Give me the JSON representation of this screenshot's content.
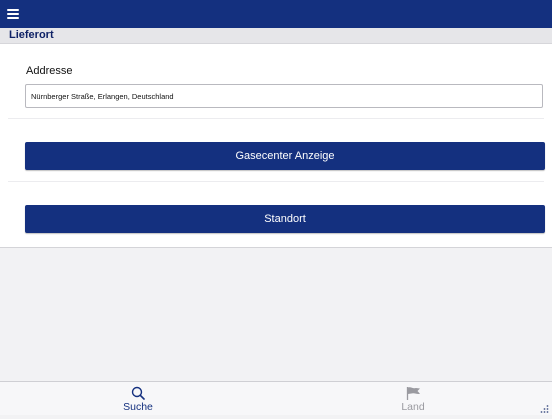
{
  "header": {
    "menu_icon": "hamburger-menu-icon"
  },
  "section": {
    "title": "Lieferort"
  },
  "form": {
    "address_label": "Addresse",
    "address_value": "Nürnberger Straße, Erlangen, Deutschland"
  },
  "buttons": {
    "gasecenter": "Gasecenter Anzeige",
    "standort": "Standort"
  },
  "tabs": [
    {
      "label": "Suche",
      "icon": "magnifier-icon",
      "active": true
    },
    {
      "label": "Land",
      "icon": "flag-icon",
      "active": false
    }
  ],
  "colors": {
    "brand": "#14307f",
    "inactive_tab": "#9a9aa0",
    "background": "#f2f2f4"
  }
}
